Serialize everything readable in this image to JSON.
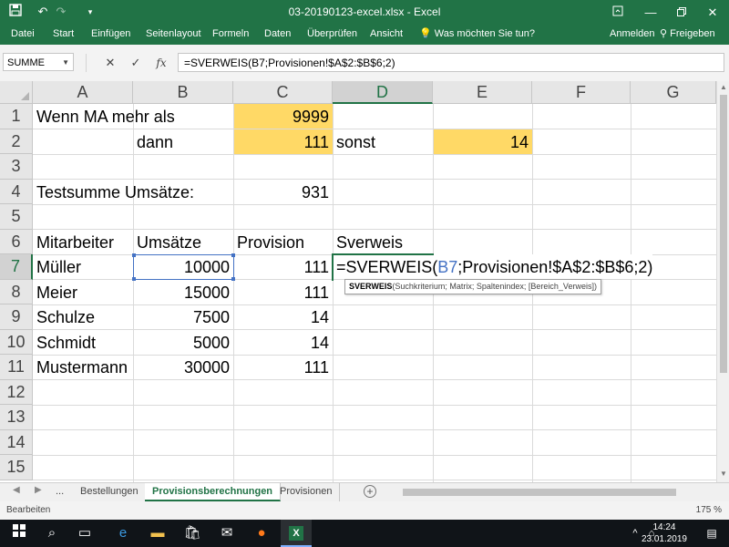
{
  "app": {
    "title": "03-20190123-excel.xlsx - Excel",
    "accent": "#217346"
  },
  "quick_access": {
    "save_icon": "save-icon",
    "undo_icon": "undo-icon",
    "redo_icon": "redo-icon",
    "customize_icon": "customize-icon"
  },
  "window_controls": {
    "ribbon_display_icon": "ribbon-display-icon",
    "minimize_icon": "minimize-icon",
    "restore_icon": "restore-icon",
    "close_icon": "close-icon"
  },
  "ribbon": {
    "tabs": [
      "Datei",
      "Start",
      "Einfügen",
      "Seitenlayout",
      "Formeln",
      "Daten",
      "Überprüfen",
      "Ansicht"
    ],
    "tell_me": "Was möchten Sie tun?",
    "signin": "Anmelden",
    "share": "Freigeben"
  },
  "formula_bar": {
    "name_box": "SUMME",
    "formula": "=SVERWEIS(B7;Provisionen!$A$2:$B$6;2)",
    "fx": "fx"
  },
  "grid": {
    "columns": [
      "A",
      "B",
      "C",
      "D",
      "E",
      "F",
      "G"
    ],
    "rows": [
      "1",
      "2",
      "3",
      "4",
      "5",
      "6",
      "7",
      "8",
      "9",
      "10",
      "11",
      "12",
      "13",
      "14",
      "15"
    ],
    "cells": {
      "A1": "Wenn MA mehr als",
      "C1": "9999",
      "B2": "dann",
      "C2": "111",
      "D2": "sonst",
      "E2": "14",
      "A4": "Testsumme Umsätze:",
      "C4": "931",
      "A6": "Mitarbeiter",
      "B6": "Umsätze",
      "C6": "Provision",
      "D6": "Sverweis",
      "A7": "Müller",
      "B7": "10000",
      "C7": "111",
      "A8": "Meier",
      "B8": "15000",
      "C8": "111",
      "A9": "Schulze",
      "B9": "7500",
      "C9": "14",
      "A10": "Schmidt",
      "B10": "5000",
      "C10": "14",
      "A11": "Mustermann",
      "B11": "30000",
      "C11": "111"
    },
    "edit": {
      "prefix": "=SVERWEIS(",
      "ref": "B7",
      "suffix": ";Provisionen!$A$2:$B$6;2)"
    },
    "tooltip": {
      "fn": "SVERWEIS",
      "args": "(Suchkriterium; Matrix; Spaltenindex; [Bereich_Verweis])"
    },
    "highlight_color": "#ffd966",
    "reference_color": "#4472c4"
  },
  "sheets": {
    "nav_prev": "◀",
    "nav_next": "▶",
    "more": "...",
    "tabs": [
      "Bestellungen",
      "Provisionsberechnungen",
      "Provisionen"
    ],
    "active": "Provisionsberechnungen"
  },
  "status": {
    "mode": "Bearbeiten",
    "zoom": "175 %"
  },
  "taskbar": {
    "time": "14:24",
    "date": "23.01.2019"
  }
}
